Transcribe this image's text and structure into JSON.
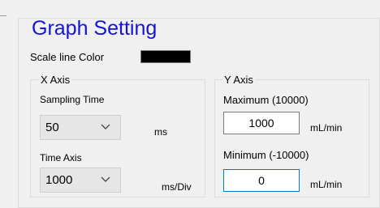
{
  "graph_setting": {
    "title": "Graph Setting",
    "scale_line_color_label": "Scale line Color",
    "scale_line_color": "#000000"
  },
  "x_axis": {
    "title": "X Axis",
    "sampling_time_label": "Sampling Time",
    "sampling_time_value": "50",
    "sampling_time_unit": "ms",
    "time_axis_label": "Time Axis",
    "time_axis_value": "1000",
    "time_axis_unit": "ms/Div",
    "dropdown_icon": "chevron-down-icon"
  },
  "y_axis": {
    "title": "Y Axis",
    "maximum_label": "Maximum (10000)",
    "maximum_value": "1000",
    "maximum_unit": "mL/min",
    "minimum_label": "Minimum (-10000)",
    "minimum_value": "0",
    "minimum_unit": "mL/min"
  },
  "colors": {
    "title_color": "#1414d2",
    "focus_border": "#0078d7"
  }
}
